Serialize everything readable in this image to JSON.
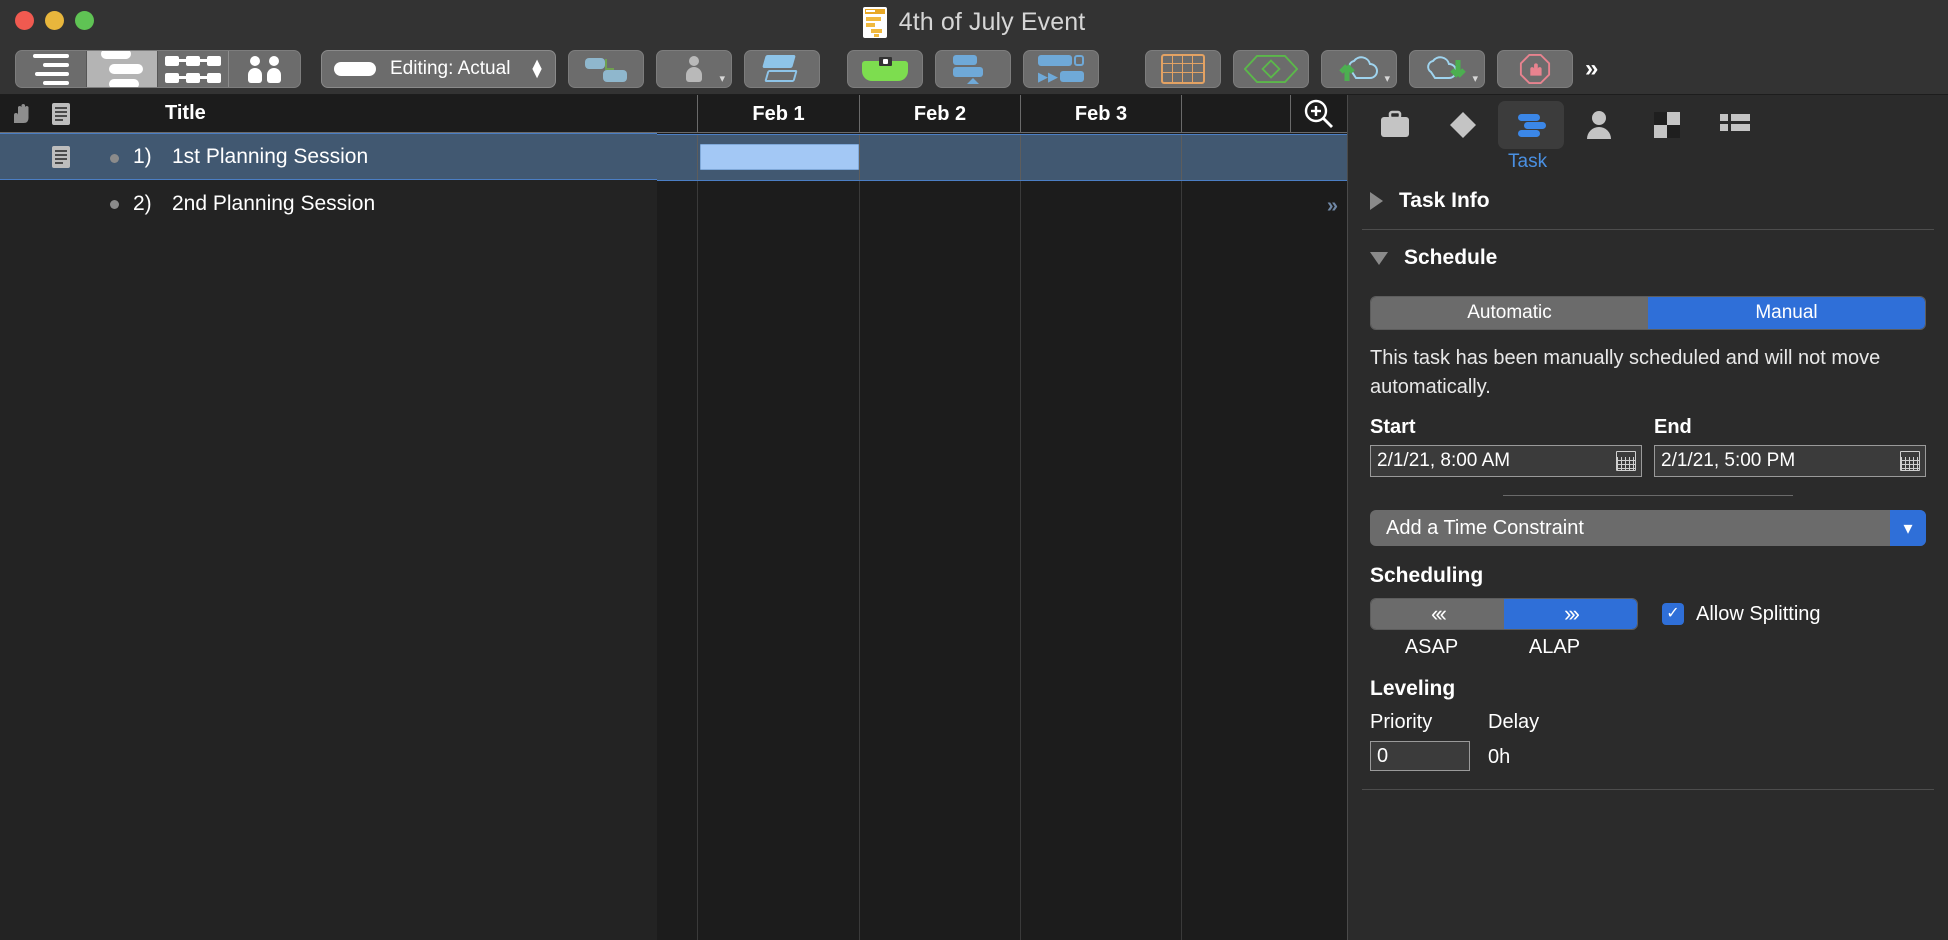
{
  "window": {
    "title": "4th of July Event",
    "traffic_lights": [
      "close",
      "minimize",
      "maximize"
    ]
  },
  "toolbar": {
    "view_segments": [
      {
        "name": "outline-view",
        "icon": "outline-icon",
        "active": false
      },
      {
        "name": "gantt-view",
        "icon": "gantt-chart-icon",
        "active": true
      },
      {
        "name": "network-view",
        "icon": "network-diagram-icon",
        "active": false
      },
      {
        "name": "resource-view",
        "icon": "people-icon",
        "active": false
      }
    ],
    "editing_popup": {
      "label": "Editing: Actual"
    },
    "buttons": [
      {
        "name": "link-tasks-button",
        "icon": "link-tasks-icon"
      },
      {
        "name": "assign-resource-button",
        "icon": "person-dropdown-icon"
      },
      {
        "name": "indent-button",
        "icon": "parallelogram-icon"
      },
      {
        "name": "level-resources-button",
        "icon": "level-icon"
      },
      {
        "name": "split-task-button",
        "icon": "split-task-icon"
      },
      {
        "name": "fast-track-button",
        "icon": "fast-forward-icon"
      },
      {
        "name": "table-button",
        "icon": "table-icon"
      },
      {
        "name": "diamond-button",
        "icon": "diamond-outline-icon"
      },
      {
        "name": "upload-button",
        "icon": "cloud-upload-icon"
      },
      {
        "name": "download-button",
        "icon": "cloud-download-icon"
      },
      {
        "name": "stop-button",
        "icon": "stop-hand-icon"
      }
    ],
    "overflow_label": "»"
  },
  "outline": {
    "columns": [
      {
        "name": "hand-column",
        "label": ""
      },
      {
        "name": "note-column",
        "label": ""
      },
      {
        "name": "title-column",
        "label": "Title"
      }
    ],
    "rows": [
      {
        "number": "1)",
        "title": "1st Planning Session",
        "selected": true,
        "has_note": true
      },
      {
        "number": "2)",
        "title": "2nd Planning Session",
        "selected": false,
        "has_note": false
      }
    ]
  },
  "gantt": {
    "date_headers": [
      "Feb 1",
      "Feb 2",
      "Feb 3"
    ],
    "zoom_icon": "zoom-in-icon",
    "row_overflow_chevron": "»",
    "bars": [
      {
        "row": 0,
        "label": "",
        "color": "#a3c8f5"
      }
    ]
  },
  "inspector": {
    "tabs": [
      {
        "name": "project-tab",
        "icon": "briefcase-icon",
        "active": false
      },
      {
        "name": "milestone-tab",
        "icon": "diamond-icon",
        "active": false
      },
      {
        "name": "task-tab",
        "icon": "task-bars-icon",
        "active": true
      },
      {
        "name": "resource-tab",
        "icon": "person-icon",
        "active": false
      },
      {
        "name": "assignment-tab",
        "icon": "checkerboard-icon",
        "active": false
      },
      {
        "name": "list-tab",
        "icon": "list-grid-icon",
        "active": false
      }
    ],
    "active_tab_label": "Task",
    "sections": {
      "task_info": {
        "title": "Task Info",
        "expanded": false
      },
      "schedule": {
        "title": "Schedule",
        "expanded": true,
        "mode_options": [
          "Automatic",
          "Manual"
        ],
        "mode_selected": "Manual",
        "description": "This task has been manually scheduled and will not move automatically.",
        "start_label": "Start",
        "start_value": "2/1/21, 8:00 AM",
        "end_label": "End",
        "end_value": "2/1/21, 5:00 PM",
        "constraint_label": "Add a Time Constraint",
        "scheduling_label": "Scheduling",
        "asap_label": "ASAP",
        "alap_label": "ALAP",
        "asap_glyph": "‹‹‹",
        "alap_glyph": "›››",
        "direction_selected": "ALAP",
        "allow_splitting_label": "Allow Splitting",
        "allow_splitting_checked": true,
        "leveling_label": "Leveling",
        "priority_label": "Priority",
        "priority_value": "0",
        "delay_label": "Delay",
        "delay_value": "0h"
      }
    }
  },
  "colors": {
    "accent_blue": "#2f6fd8",
    "selection_blue": "#415871",
    "task_bar": "#a3c8f5",
    "window_bg": "#2b2b2b",
    "toolbar_bg": "#333333",
    "tab_label_blue": "#4a90e2"
  }
}
